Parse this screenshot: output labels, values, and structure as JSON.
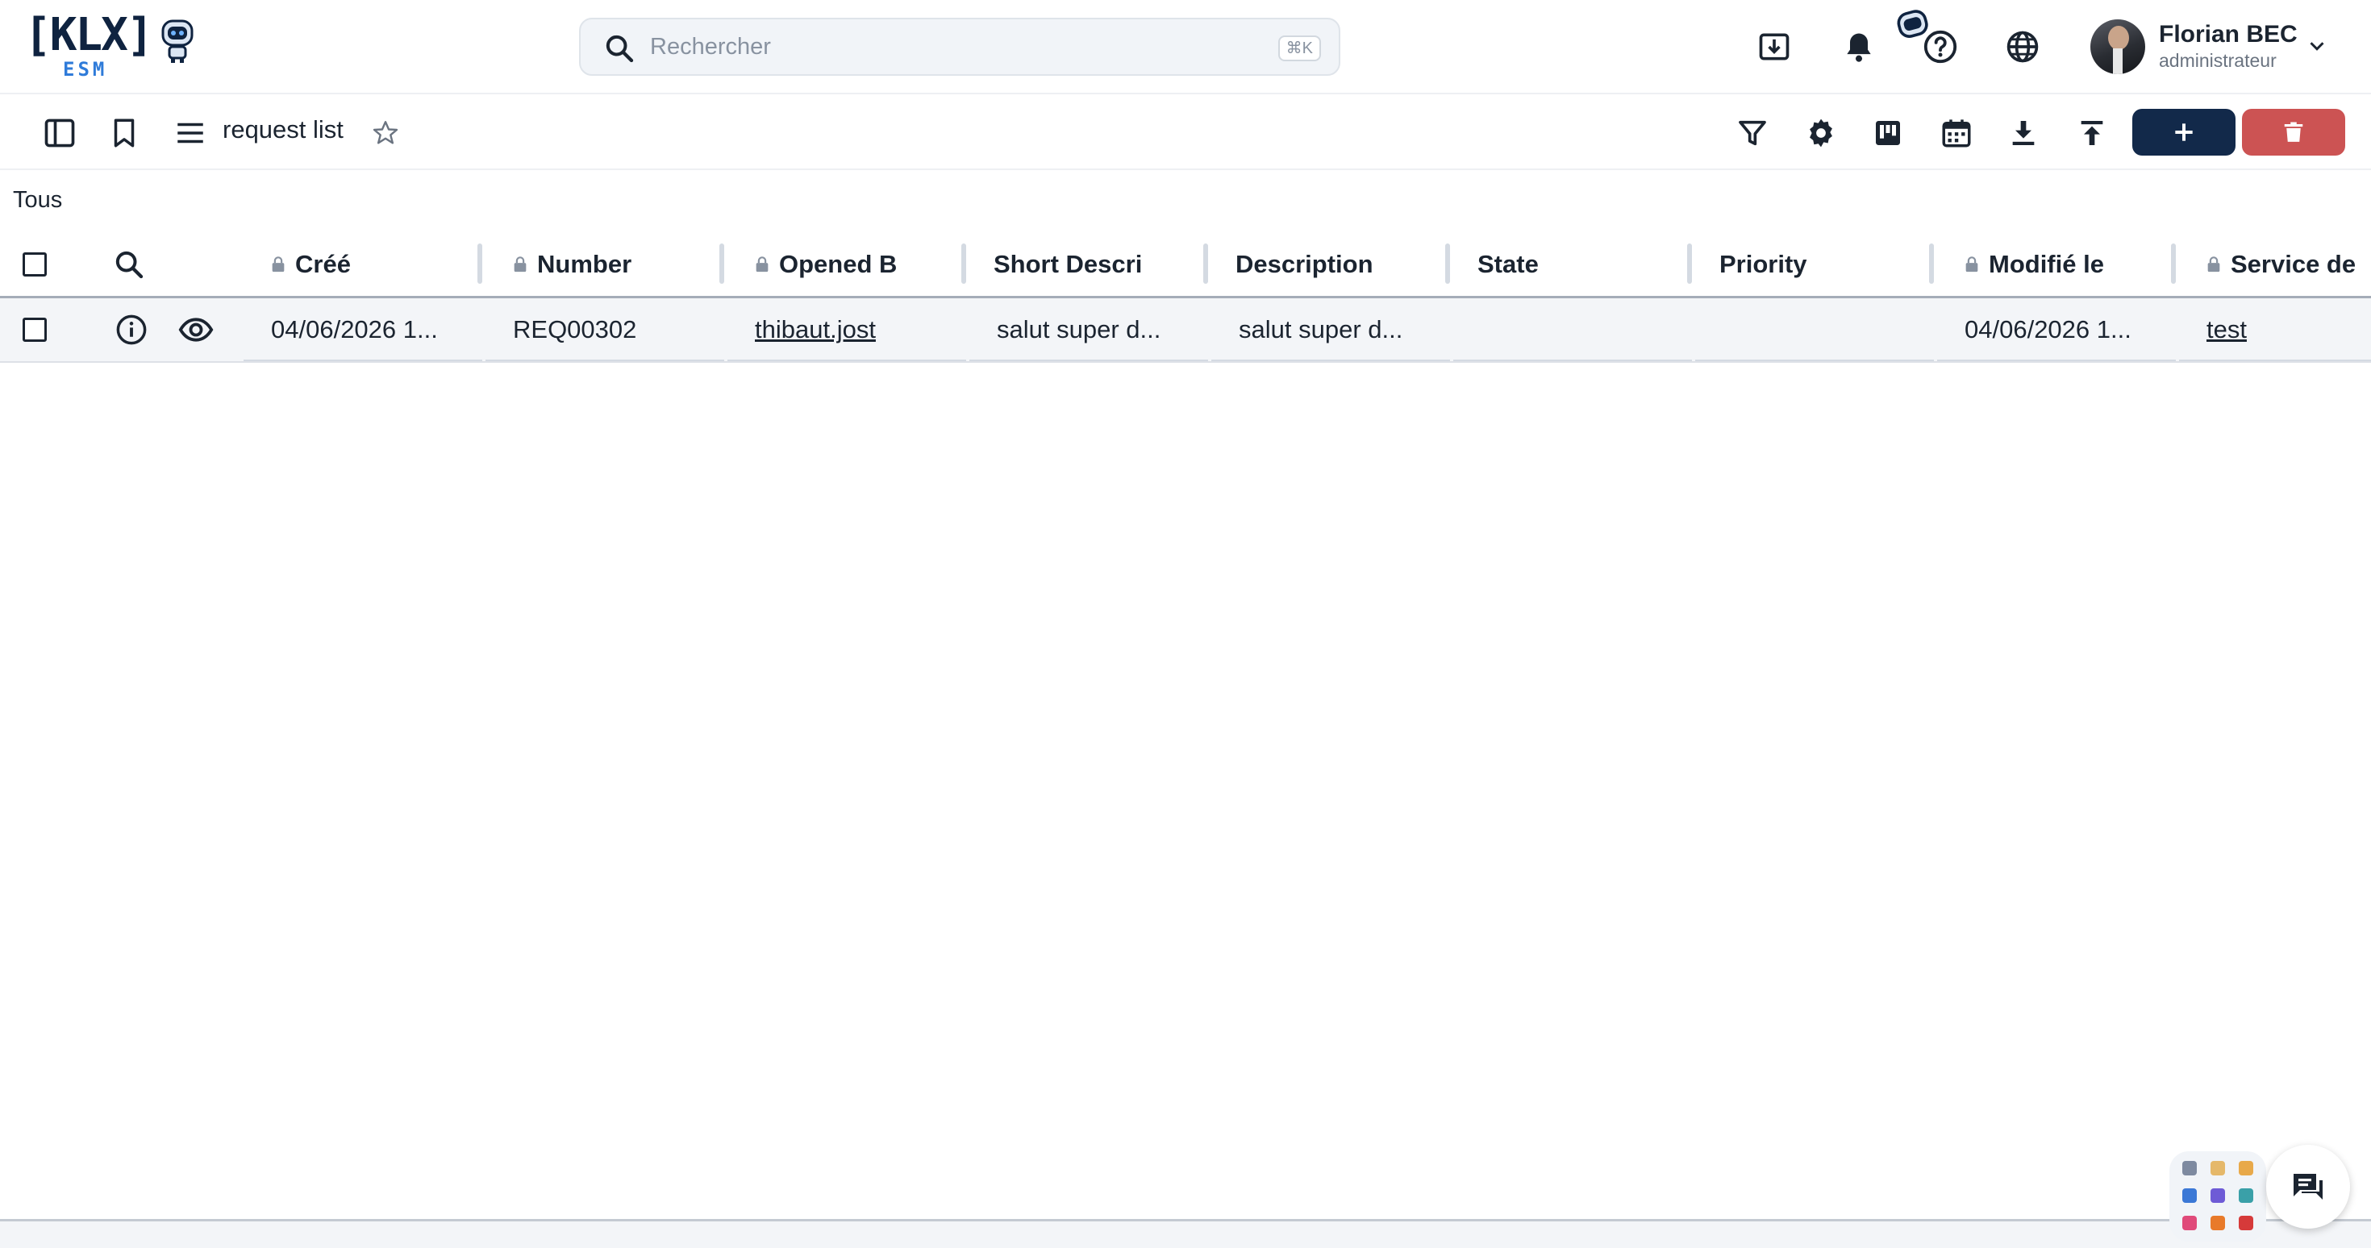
{
  "header": {
    "logo_text": "[KLX]",
    "logo_sub": "ESM",
    "search_placeholder": "Rechercher",
    "search_shortcut": "⌘K",
    "user": {
      "name": "Florian BEC",
      "role": "administrateur"
    },
    "icons": [
      "download-box-icon",
      "bell-icon",
      "robot-icon",
      "help-icon",
      "globe-icon",
      "chevron-down-icon"
    ]
  },
  "toolbar": {
    "list_title": "request list",
    "icons": [
      "sidebar-toggle-icon",
      "bookmark-icon",
      "menu-icon",
      "star-icon",
      "filter-icon",
      "gear-icon",
      "kanban-icon",
      "calendar-icon",
      "download-icon",
      "upload-icon",
      "plus-icon",
      "trash-icon"
    ]
  },
  "filter": {
    "label": "Tous"
  },
  "table": {
    "columns": [
      {
        "label": "Créé",
        "locked": true
      },
      {
        "label": "Number",
        "locked": true
      },
      {
        "label": "Opened B",
        "locked": true
      },
      {
        "label": "Short Descri",
        "locked": false
      },
      {
        "label": "Description",
        "locked": false
      },
      {
        "label": "State",
        "locked": false
      },
      {
        "label": "Priority",
        "locked": false
      },
      {
        "label": "Modifié le",
        "locked": true
      },
      {
        "label": "Service de",
        "locked": true
      }
    ],
    "rows": [
      {
        "created": "04/06/2026 1...",
        "number": "REQ00302",
        "opened_by": "thibaut.jost",
        "short_description": "salut super d...",
        "description": "salut super d...",
        "state": "",
        "priority": "",
        "modified": "04/06/2026 1...",
        "service": "test"
      }
    ]
  },
  "colors": {
    "primary": "#12294a",
    "danger": "#cc5353",
    "logo_blue": "#2f7bd9",
    "row_bg": "#f3f5f8"
  }
}
